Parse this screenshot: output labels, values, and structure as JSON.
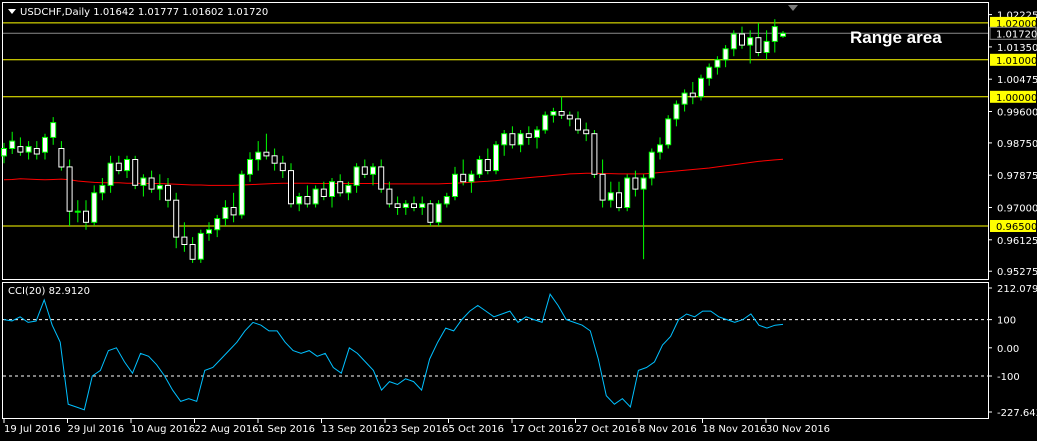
{
  "header": {
    "symbol_info": "USDCHF,Daily  1.01642 1.01777 1.01602 1.01720",
    "indicator_label": "CCI(20) 82.9120"
  },
  "annotation": {
    "text": "Range area"
  },
  "colors": {
    "background": "#000000",
    "grid": "#ffffff",
    "bull_candle": "#ffffff",
    "wick": "#00ff00",
    "ma": "#ff0000",
    "hline": "#ffff00",
    "price_box": "#ffff00",
    "cci": "#00c0ff"
  },
  "price_axis": {
    "ticks": [
      "1.02225",
      "1.01350",
      "1.00475",
      "0.99600",
      "0.98750",
      "0.97875",
      "0.97000",
      "0.96125",
      "0.95275"
    ],
    "highlighted": [
      {
        "label": "1.02000",
        "value": 1.02
      },
      {
        "label": "1.01720",
        "value": 1.0172,
        "current": true
      },
      {
        "label": "1.01000",
        "value": 1.01
      },
      {
        "label": "1.00000",
        "value": 1.0
      },
      {
        "label": "0.96500",
        "value": 0.965
      }
    ]
  },
  "cci_axis": {
    "ticks": [
      "212.0792",
      "100",
      "0.00",
      "-100",
      "-227.6436"
    ]
  },
  "time_axis": {
    "labels": [
      "19 Jul 2016",
      "29 Jul 2016",
      "10 Aug 2016",
      "22 Aug 2016",
      "1 Sep 2016",
      "13 Sep 2016",
      "23 Sep 2016",
      "5 Oct 2016",
      "17 Oct 2016",
      "27 Oct 2016",
      "8 Nov 2016",
      "18 Nov 2016",
      "30 Nov 2016"
    ]
  },
  "chart_data": [
    {
      "type": "candlestick",
      "title": "USDCHF,Daily",
      "ylim": [
        0.952,
        1.0235
      ],
      "horizontal_lines": [
        1.02,
        1.01,
        1.0,
        0.965
      ],
      "candles": [
        [
          0.984,
          0.9875,
          0.982,
          0.986
        ],
        [
          0.986,
          0.9905,
          0.9845,
          0.988
        ],
        [
          0.9865,
          0.989,
          0.984,
          0.985
        ],
        [
          0.985,
          0.988,
          0.983,
          0.9865
        ],
        [
          0.986,
          0.988,
          0.983,
          0.9845
        ],
        [
          0.985,
          0.99,
          0.983,
          0.989
        ],
        [
          0.989,
          0.9945,
          0.987,
          0.993
        ],
        [
          0.986,
          0.988,
          0.98,
          0.981
        ],
        [
          0.981,
          0.983,
          0.965,
          0.969
        ],
        [
          0.969,
          0.972,
          0.966,
          0.969
        ],
        [
          0.969,
          0.972,
          0.964,
          0.966
        ],
        [
          0.966,
          0.976,
          0.965,
          0.974
        ],
        [
          0.974,
          0.978,
          0.972,
          0.976
        ],
        [
          0.976,
          0.984,
          0.974,
          0.982
        ],
        [
          0.982,
          0.984,
          0.979,
          0.98
        ],
        [
          0.98,
          0.984,
          0.978,
          0.983
        ],
        [
          0.983,
          0.984,
          0.975,
          0.976
        ],
        [
          0.976,
          0.979,
          0.973,
          0.978
        ],
        [
          0.978,
          0.98,
          0.974,
          0.975
        ],
        [
          0.975,
          0.979,
          0.972,
          0.976
        ],
        [
          0.976,
          0.978,
          0.97,
          0.972
        ],
        [
          0.972,
          0.974,
          0.959,
          0.962
        ],
        [
          0.962,
          0.966,
          0.958,
          0.96
        ],
        [
          0.96,
          0.962,
          0.955,
          0.956
        ],
        [
          0.956,
          0.964,
          0.955,
          0.963
        ],
        [
          0.963,
          0.966,
          0.961,
          0.964
        ],
        [
          0.964,
          0.968,
          0.962,
          0.967
        ],
        [
          0.967,
          0.972,
          0.965,
          0.97
        ],
        [
          0.97,
          0.974,
          0.966,
          0.968
        ],
        [
          0.968,
          0.98,
          0.967,
          0.979
        ],
        [
          0.979,
          0.985,
          0.977,
          0.983
        ],
        [
          0.983,
          0.988,
          0.98,
          0.985
        ],
        [
          0.985,
          0.99,
          0.983,
          0.984
        ],
        [
          0.984,
          0.986,
          0.98,
          0.982
        ],
        [
          0.982,
          0.984,
          0.978,
          0.98
        ],
        [
          0.98,
          0.982,
          0.97,
          0.971
        ],
        [
          0.971,
          0.974,
          0.969,
          0.973
        ],
        [
          0.973,
          0.976,
          0.97,
          0.971
        ],
        [
          0.971,
          0.976,
          0.97,
          0.975
        ],
        [
          0.975,
          0.977,
          0.972,
          0.973
        ],
        [
          0.973,
          0.978,
          0.97,
          0.977
        ],
        [
          0.977,
          0.979,
          0.973,
          0.974
        ],
        [
          0.974,
          0.977,
          0.972,
          0.976
        ],
        [
          0.976,
          0.982,
          0.974,
          0.981
        ],
        [
          0.981,
          0.983,
          0.978,
          0.979
        ],
        [
          0.979,
          0.982,
          0.976,
          0.981
        ],
        [
          0.981,
          0.983,
          0.974,
          0.975
        ],
        [
          0.975,
          0.977,
          0.97,
          0.971
        ],
        [
          0.971,
          0.973,
          0.968,
          0.97
        ],
        [
          0.97,
          0.972,
          0.968,
          0.971
        ],
        [
          0.971,
          0.973,
          0.969,
          0.97
        ],
        [
          0.97,
          0.973,
          0.968,
          0.971
        ],
        [
          0.971,
          0.972,
          0.965,
          0.966
        ],
        [
          0.966,
          0.972,
          0.965,
          0.971
        ],
        [
          0.971,
          0.974,
          0.97,
          0.973
        ],
        [
          0.973,
          0.981,
          0.972,
          0.979
        ],
        [
          0.979,
          0.983,
          0.976,
          0.977
        ],
        [
          0.977,
          0.98,
          0.974,
          0.979
        ],
        [
          0.979,
          0.984,
          0.978,
          0.983
        ],
        [
          0.983,
          0.986,
          0.979,
          0.98
        ],
        [
          0.98,
          0.988,
          0.979,
          0.987
        ],
        [
          0.987,
          0.991,
          0.984,
          0.99
        ],
        [
          0.99,
          0.992,
          0.986,
          0.987
        ],
        [
          0.987,
          0.991,
          0.985,
          0.99
        ],
        [
          0.99,
          0.992,
          0.987,
          0.989
        ],
        [
          0.989,
          0.992,
          0.986,
          0.991
        ],
        [
          0.991,
          0.996,
          0.99,
          0.995
        ],
        [
          0.995,
          0.997,
          0.993,
          0.996
        ],
        [
          0.996,
          1.0,
          0.994,
          0.995
        ],
        [
          0.995,
          0.996,
          0.992,
          0.994
        ],
        [
          0.994,
          0.996,
          0.99,
          0.991
        ],
        [
          0.991,
          0.993,
          0.988,
          0.99
        ],
        [
          0.99,
          0.991,
          0.978,
          0.979
        ],
        [
          0.979,
          0.983,
          0.97,
          0.972
        ],
        [
          0.972,
          0.977,
          0.97,
          0.974
        ],
        [
          0.974,
          0.977,
          0.969,
          0.97
        ],
        [
          0.97,
          0.979,
          0.969,
          0.978
        ],
        [
          0.978,
          0.98,
          0.973,
          0.975
        ],
        [
          0.975,
          0.979,
          0.956,
          0.978
        ],
        [
          0.978,
          0.986,
          0.976,
          0.985
        ],
        [
          0.985,
          0.989,
          0.983,
          0.987
        ],
        [
          0.987,
          0.995,
          0.986,
          0.994
        ],
        [
          0.994,
          0.999,
          0.992,
          0.998
        ],
        [
          0.998,
          1.002,
          0.996,
          1.001
        ],
        [
          1.001,
          1.004,
          0.998,
          1.0
        ],
        [
          1.0,
          1.006,
          0.999,
          1.005
        ],
        [
          1.005,
          1.009,
          1.003,
          1.008
        ],
        [
          1.008,
          1.011,
          1.006,
          1.01
        ],
        [
          1.01,
          1.014,
          1.008,
          1.013
        ],
        [
          1.013,
          1.018,
          1.011,
          1.017
        ],
        [
          1.017,
          1.019,
          1.013,
          1.014
        ],
        [
          1.014,
          1.018,
          1.009,
          1.016
        ],
        [
          1.016,
          1.02,
          1.011,
          1.012
        ],
        [
          1.012,
          1.018,
          1.01,
          1.015
        ],
        [
          1.015,
          1.021,
          1.012,
          1.019
        ],
        [
          1.0164,
          1.0178,
          1.016,
          1.0172
        ]
      ],
      "ma": [
        0.9775,
        0.9776,
        0.9778,
        0.9777,
        0.9776,
        0.9775,
        0.9776,
        0.9777,
        0.9775,
        0.9772,
        0.977,
        0.9768,
        0.9767,
        0.9767,
        0.9767,
        0.9766,
        0.9766,
        0.9765,
        0.9765,
        0.9765,
        0.9764,
        0.9763,
        0.9762,
        0.9761,
        0.9761,
        0.976,
        0.976,
        0.976,
        0.976,
        0.9761,
        0.9762,
        0.9763,
        0.9764,
        0.9765,
        0.9766,
        0.9766,
        0.9766,
        0.9766,
        0.9765,
        0.9765,
        0.9765,
        0.9765,
        0.9765,
        0.9765,
        0.9765,
        0.9765,
        0.9765,
        0.9764,
        0.9764,
        0.9764,
        0.9764,
        0.9764,
        0.9764,
        0.9764,
        0.9765,
        0.9766,
        0.9767,
        0.9768,
        0.977,
        0.9771,
        0.9773,
        0.9775,
        0.9777,
        0.9779,
        0.9781,
        0.9783,
        0.9785,
        0.9787,
        0.9789,
        0.9791,
        0.9792,
        0.9793,
        0.9793,
        0.9792,
        0.9792,
        0.9791,
        0.9791,
        0.9791,
        0.9791,
        0.9793,
        0.9795,
        0.9797,
        0.9799,
        0.9801,
        0.9803,
        0.9805,
        0.9807,
        0.981,
        0.9813,
        0.9816,
        0.9819,
        0.9822,
        0.9825,
        0.9827,
        0.9829,
        0.9831
      ]
    },
    {
      "type": "line",
      "title": "CCI(20) 82.9120",
      "ylim": [
        -227.6436,
        212.0792
      ],
      "levels": [
        100,
        -100
      ],
      "values": [
        100,
        95,
        110,
        90,
        95,
        170,
        80,
        20,
        -200,
        -210,
        -220,
        -100,
        -80,
        -10,
        0,
        -50,
        -90,
        -20,
        -30,
        -60,
        -100,
        -150,
        -190,
        -180,
        -190,
        -80,
        -70,
        -40,
        -10,
        20,
        60,
        90,
        80,
        60,
        60,
        20,
        -10,
        -20,
        -10,
        -30,
        -20,
        -70,
        -90,
        0,
        -20,
        -50,
        -80,
        -150,
        -120,
        -130,
        -110,
        -120,
        -150,
        -40,
        20,
        70,
        60,
        100,
        130,
        150,
        130,
        110,
        120,
        130,
        90,
        110,
        100,
        90,
        190,
        150,
        100,
        90,
        80,
        60,
        -40,
        -170,
        -200,
        -180,
        -210,
        -80,
        -70,
        -50,
        10,
        40,
        100,
        120,
        110,
        130,
        130,
        110,
        100,
        90,
        100,
        120,
        80,
        70,
        80,
        82.9
      ]
    }
  ]
}
